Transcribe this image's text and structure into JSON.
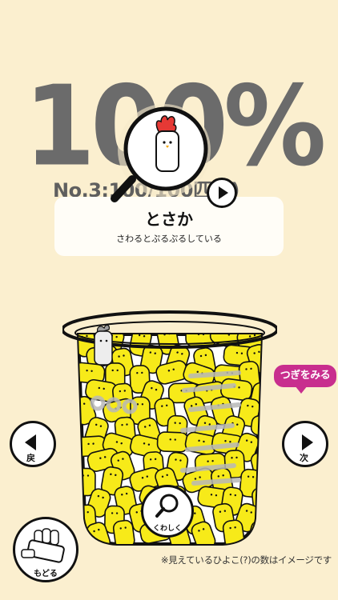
{
  "header": {
    "percent": "100%",
    "record": "No.3:100/100匹(?)"
  },
  "card": {
    "title": "とさか",
    "description": "さわるとぷるぷるしている"
  },
  "nav": {
    "prev_label": "戻",
    "next_label": "次",
    "next_bubble": "つぎをみる"
  },
  "detail_label": "くわしく",
  "back_label": "もどる",
  "footnote": "※見えているひよこ(?)の数はイメージです",
  "colors": {
    "background": "#FBEFCF",
    "chick_yellow": "#F7EA19",
    "bubble": "#C82E8E",
    "comb_red": "#E53935",
    "percent_gray": "#6b6b6b"
  },
  "icons": [
    "magnifier-icon",
    "rooster-icon",
    "play-icon",
    "arrow-left-icon",
    "arrow-right-icon",
    "magnifier-small-icon",
    "chick-group-icon"
  ]
}
